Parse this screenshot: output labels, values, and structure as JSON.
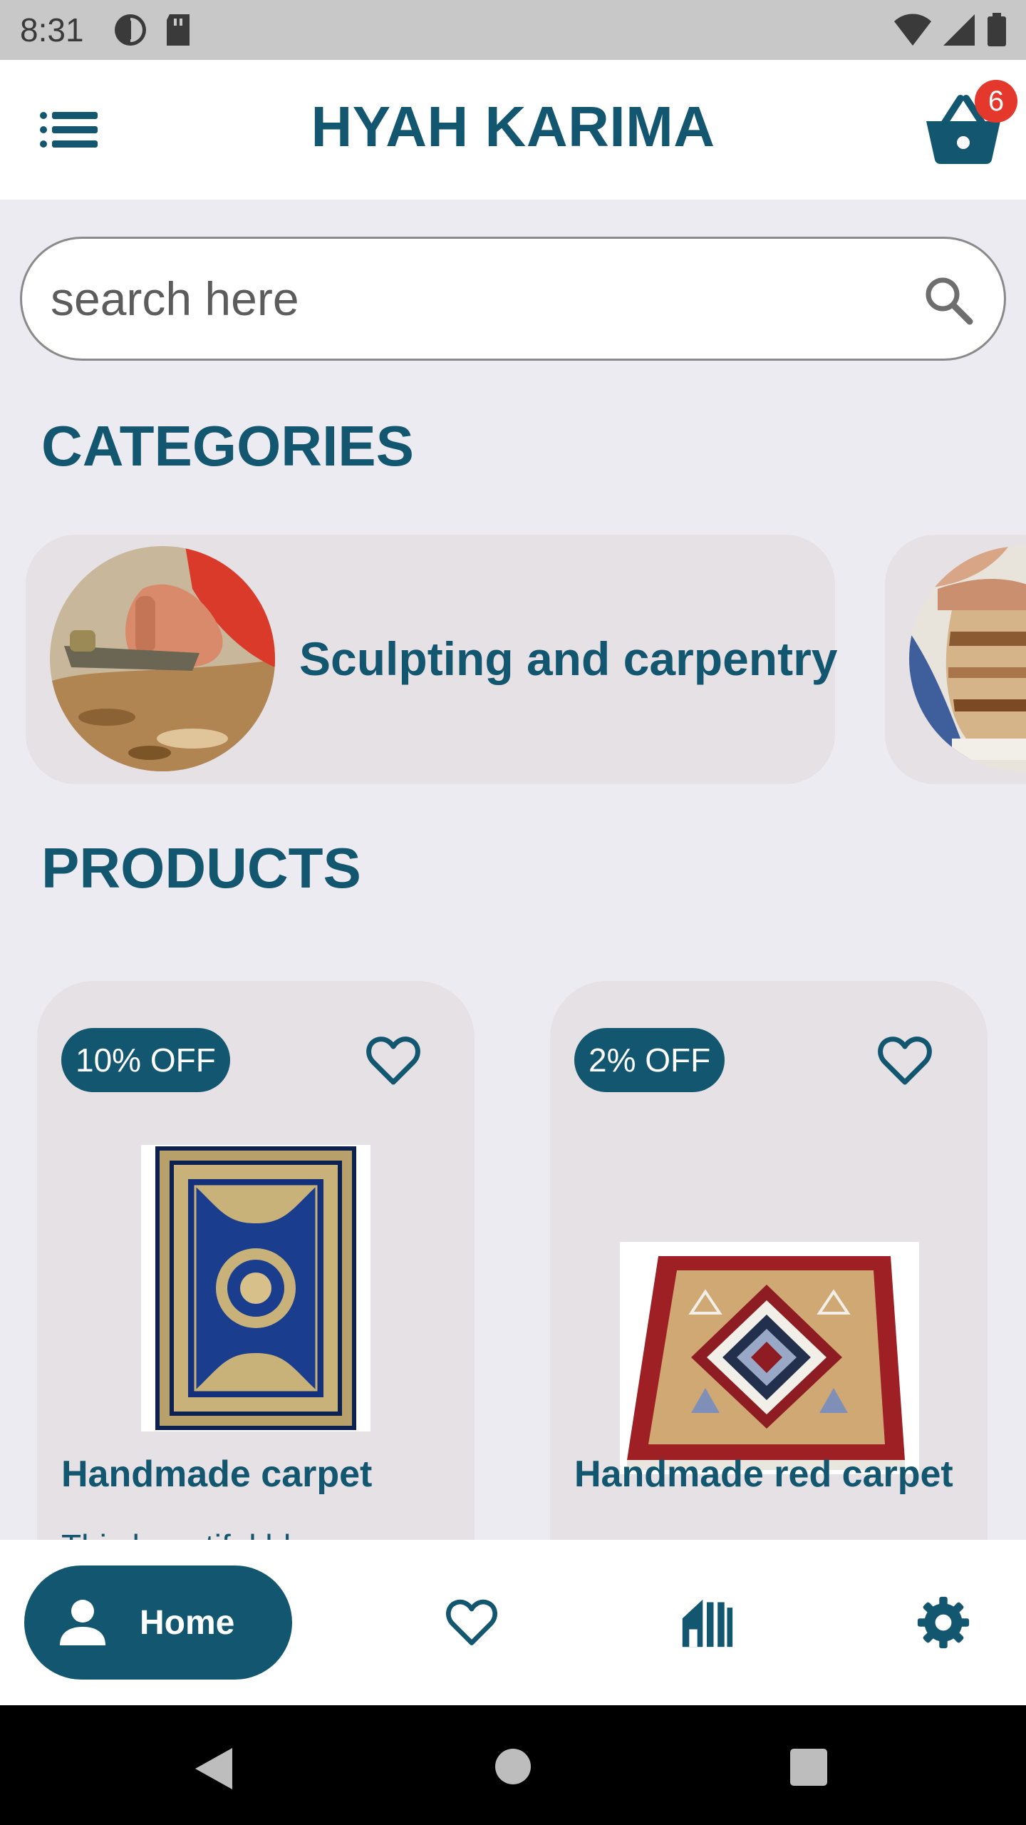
{
  "status_bar": {
    "time": "8:31",
    "icons": [
      "ring-icon",
      "sd-card-icon",
      "wifi-icon",
      "signal-icon",
      "battery-icon"
    ]
  },
  "app_bar": {
    "title": "HYAH KARIMA",
    "menu_icon": "list-menu-icon",
    "cart_icon": "basket-icon",
    "cart_count": "6"
  },
  "search": {
    "placeholder": "search here",
    "value": ""
  },
  "sections": {
    "categories_title": "CATEGORIES",
    "products_title": "PRODUCTS"
  },
  "categories": [
    {
      "label": "Sculpting and carpentry",
      "image": "carpentry-photo"
    },
    {
      "label": "",
      "image": "pottery-photo"
    }
  ],
  "products": [
    {
      "discount": "10% OFF",
      "name": "Handmade carpet",
      "description": "This beautiful blue",
      "image": "blue-carpet-photo",
      "favorite": false
    },
    {
      "discount": "2% OFF",
      "name": "Handmade red carpet",
      "description": "",
      "image": "red-carpet-photo",
      "favorite": false
    }
  ],
  "bottom_nav": {
    "home_label": "Home",
    "items": [
      "person-icon",
      "heart-icon",
      "store-icon",
      "gear-icon"
    ]
  },
  "colors": {
    "primary": "#13566f",
    "background": "#ecebf1",
    "card": "#e5e1e5",
    "badge": "#e5382d"
  }
}
